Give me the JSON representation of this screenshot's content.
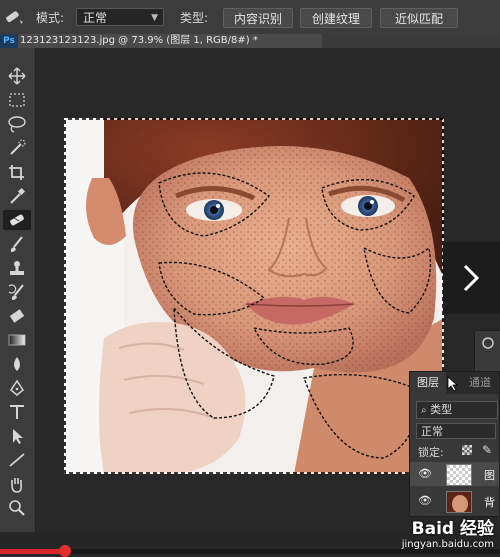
{
  "options_bar": {
    "mode_label": "模式:",
    "mode_value": "正常",
    "type_label": "类型:",
    "type_buttons": [
      "内容识别",
      "创建纹理",
      "近似匹配"
    ]
  },
  "document": {
    "app_badge": "Ps",
    "tab_title": "123123123123.jpg @ 73.9% (图层 1, RGB/8#) *"
  },
  "layers_panel": {
    "tabs": [
      "图层",
      "通道"
    ],
    "filter_value": "类型",
    "blend_mode": "正常",
    "lock_label": "锁定:",
    "layers": [
      {
        "name": "图",
        "visible": true
      },
      {
        "name": "背",
        "visible": true
      }
    ]
  },
  "video": {
    "progress": 0.13
  },
  "watermark": {
    "main": "Baid 经验",
    "url": "jingyan.baidu.com"
  },
  "colors": {
    "accent": "#d6262b",
    "panel": "#3c3c3c",
    "canvas": "#282828"
  }
}
